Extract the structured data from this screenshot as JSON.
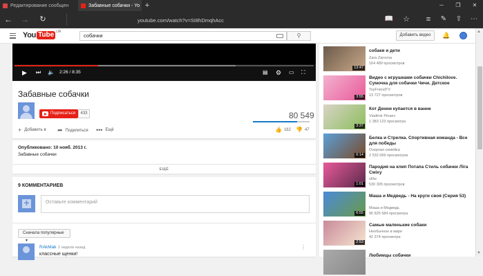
{
  "browser": {
    "tabs": [
      {
        "title": "Редактирование сообщен",
        "favicon_color": "#d44"
      },
      {
        "title": "Забавные собачки - Yo",
        "favicon_color": "#e62117"
      }
    ],
    "new_tab": "+",
    "url": "youtube.com/watch?v=SI8hDmqhAcc"
  },
  "header": {
    "logo_you": "You",
    "logo_tube": "Tube",
    "logo_region": "UA",
    "search_value": "собачки",
    "upload_label": "Добавить видео"
  },
  "player": {
    "time": "2:26 / 8:35",
    "progress": 0.28,
    "buffered": 0.74
  },
  "video": {
    "title": "Забавные собачки",
    "subscribe_label": "Подписаться",
    "subscriber_count": "433",
    "views": "80 549",
    "like_ratio": 0.78,
    "actions": {
      "add": "Добавить в",
      "share": "Поделиться",
      "more": "Ещё"
    },
    "likes": "162",
    "dislikes": "47",
    "published": "Опубликовано: 10 нояб. 2013 г.",
    "description": "Забавные собачки",
    "show_more": "ЕЩЁ"
  },
  "comments": {
    "header": "9 КОММЕНТАРИЕВ",
    "input_placeholder": "Оставьте комментарий",
    "sort_label": "Сначала популярные",
    "first": {
      "author": "RAkMak",
      "date": "2 недели назад",
      "text": "классные щенки!"
    }
  },
  "sidebar": {
    "items": [
      {
        "title": "собаки и дети",
        "channel": "Zara Zarovna",
        "views": "164 489 просмотров",
        "duration": "13:47",
        "colors": [
          "#6a5a4a",
          "#caa98a"
        ]
      },
      {
        "title": "Видео с игрушками собачки Chichilove. Сумочка для собачки Чичи. Детское",
        "channel": "ToyFriendTV",
        "views": "13 727 просмотров",
        "duration": "3:55",
        "colors": [
          "#f3b2cf",
          "#e85a9a"
        ]
      },
      {
        "title": "Кот Денни купается в ванне",
        "channel": "Vladimir Pinaev",
        "views": "1 383 123 просмотра",
        "duration": "3:37",
        "colors": [
          "#d9d4c8",
          "#8bbd5a"
        ]
      },
      {
        "title": "Белка и Стрелка. Спортивная команда - Все для победы",
        "channel": "Озорная семейка",
        "views": "2 532 069 просмотров",
        "duration": "6:14",
        "colors": [
          "#5aa0d8",
          "#7a4a2a"
        ]
      },
      {
        "title": "Пародия на клип Потапа Стиль собачки Ліга Сміху",
        "channel": "sl0w",
        "views": "530 305 просмотров",
        "duration": "1:01",
        "colors": [
          "#e85a9a",
          "#5a2a4a"
        ]
      },
      {
        "title": "Маша и Медведь - На круги своя (Серия 53)",
        "channel": "Маша и Медведь",
        "views": "96 825 684 просмотра",
        "duration": "6:55",
        "colors": [
          "#4a8ad8",
          "#6a9a4a"
        ]
      },
      {
        "title": "Самые маленькие собаки",
        "channel": "Необычное в мире",
        "views": "42 374 просмотра",
        "duration": "2:53",
        "colors": [
          "#c98a9a",
          "#f5e5d0"
        ]
      },
      {
        "title": "Любимцы собачки",
        "channel": "",
        "views": "",
        "duration": "",
        "colors": [
          "#aaa",
          "#888"
        ]
      }
    ]
  }
}
